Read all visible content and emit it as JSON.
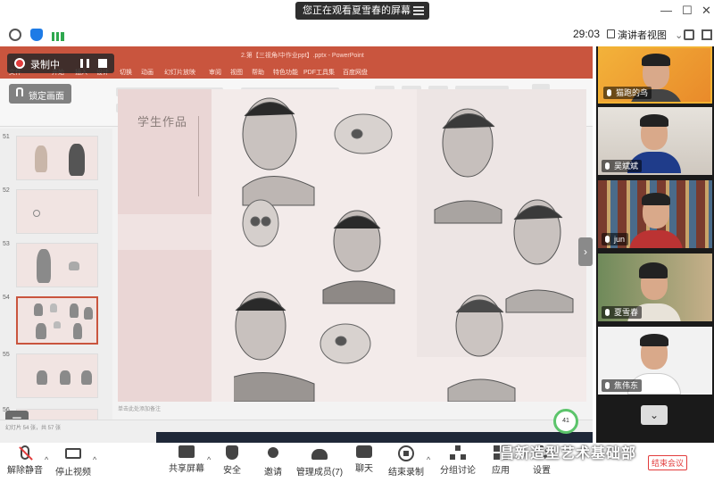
{
  "banner": {
    "text": "您正在观看夏雪春的屏幕"
  },
  "window": {
    "controls": [
      "—",
      "☐",
      "✕"
    ]
  },
  "meeting": {
    "timer": "29:03",
    "view_label": "演讲者视图"
  },
  "recording": {
    "label": "录制中"
  },
  "lock_screen": {
    "label": "锁定画面"
  },
  "ppt": {
    "title": "2.第【三视角/中作业ppt】.pptx - PowerPoint",
    "tabs": [
      "文件",
      "开始",
      "插入",
      "设计",
      "切换",
      "动画",
      "幻灯片放映",
      "审阅",
      "视图",
      "帮助",
      "特色功能",
      "PDF工具集",
      "百度网盘"
    ],
    "slide_numbers": [
      "51",
      "52",
      "53",
      "54",
      "55",
      "56"
    ],
    "slide_title": "学生作品",
    "notes_placeholder": "单击此处添加备注",
    "status": "幻灯片 54 张，共 57 张",
    "zoom": "41"
  },
  "participants": [
    {
      "name": "猫跑的鸟",
      "mic": "on"
    },
    {
      "name": "吴斌斌",
      "mic": "on"
    },
    {
      "name": "jun",
      "mic": "on"
    },
    {
      "name": "夏雪春",
      "mic": "on"
    },
    {
      "name": "焦伟东",
      "mic": "on"
    }
  ],
  "toolbar": {
    "items": [
      {
        "label": "解除静音",
        "icon": "mic-muted-icon"
      },
      {
        "label": "停止视频",
        "icon": "camera-icon"
      },
      {
        "label": "共享屏幕",
        "icon": "share-screen-icon"
      },
      {
        "label": "安全",
        "icon": "shield-icon"
      },
      {
        "label": "邀请",
        "icon": "invite-icon"
      },
      {
        "label": "管理成员(7)",
        "icon": "members-icon"
      },
      {
        "label": "聊天",
        "icon": "chat-icon"
      },
      {
        "label": "结束录制",
        "icon": "stop-record-icon"
      },
      {
        "label": "分组讨论",
        "icon": "breakout-icon"
      },
      {
        "label": "应用",
        "icon": "apps-icon"
      },
      {
        "label": "设置",
        "icon": "gear-icon"
      }
    ],
    "end_label": "结束会议"
  },
  "watermark": {
    "text": "昌新造型艺术基础部"
  },
  "colors": {
    "ppt_red": "#c9553e",
    "record_red": "#e23c3c",
    "zoom_green": "#5cc46b"
  }
}
